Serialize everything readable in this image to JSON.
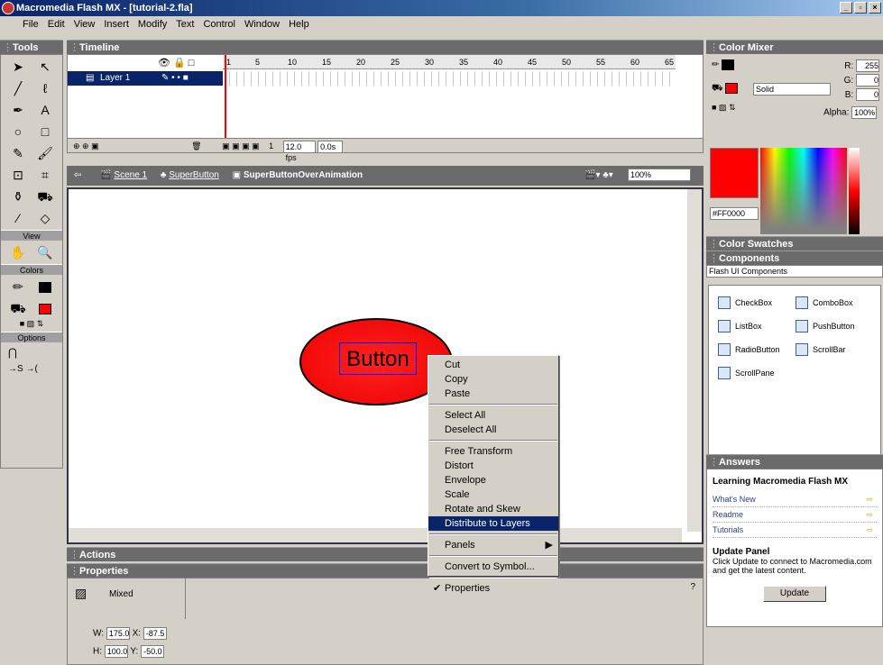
{
  "window": {
    "title": "Macromedia Flash MX - [tutorial-2.fla]"
  },
  "menu": [
    "File",
    "Edit",
    "View",
    "Insert",
    "Modify",
    "Text",
    "Control",
    "Window",
    "Help"
  ],
  "tools": {
    "title": "Tools",
    "view_label": "View",
    "colors_label": "Colors",
    "options_label": "Options"
  },
  "timeline": {
    "title": "Timeline",
    "layer_name": "Layer 1",
    "ruler": [
      "1",
      "5",
      "10",
      "15",
      "20",
      "25",
      "30",
      "35",
      "40",
      "45",
      "50",
      "55",
      "60",
      "65"
    ],
    "frame": "1",
    "fps": "12.0 fps",
    "time": "0.0s"
  },
  "editbar": {
    "scene": "Scene 1",
    "symbol1": "SuperButton",
    "symbol2": "SuperButtonOverAnimation",
    "zoom": "100%"
  },
  "stage": {
    "button_text": "Button"
  },
  "context_menu": {
    "items": [
      "Cut",
      "Copy",
      "Paste",
      "Select All",
      "Deselect All",
      "Free Transform",
      "Distort",
      "Envelope",
      "Scale",
      "Rotate and Skew",
      "Distribute to Layers",
      "Panels",
      "Convert to Symbol...",
      "Properties"
    ],
    "highlighted": "Distribute to Layers"
  },
  "actions": {
    "title": "Actions"
  },
  "properties": {
    "title": "Properties",
    "type": "Mixed",
    "w_label": "W:",
    "w": "175.0",
    "x_label": "X:",
    "x": "-87.5",
    "h_label": "H:",
    "h": "100.0",
    "y_label": "Y:",
    "y": "-50.0"
  },
  "color_mixer": {
    "title": "Color Mixer",
    "r_label": "R:",
    "r": "255",
    "g_label": "G:",
    "g": "0",
    "b_label": "B:",
    "b": "0",
    "alpha_label": "Alpha:",
    "alpha": "100%",
    "fill_type": "Solid",
    "hex": "#FF0000"
  },
  "color_swatches": {
    "title": "Color Swatches"
  },
  "components": {
    "title": "Components",
    "set": "Flash UI Components",
    "items": [
      "CheckBox",
      "ComboBox",
      "ListBox",
      "PushButton",
      "RadioButton",
      "ScrollBar",
      "ScrollPane"
    ]
  },
  "answers": {
    "title": "Answers",
    "heading": "Learning Macromedia Flash MX",
    "links": [
      "What's New",
      "Readme",
      "Tutorials"
    ],
    "update_title": "Update Panel",
    "update_text": "Click Update to connect to Macromedia.com and get the latest content.",
    "update_button": "Update"
  },
  "colors": {
    "accent": "#0a246a",
    "panel": "#6b6b6b",
    "fill": "#ff0000"
  }
}
